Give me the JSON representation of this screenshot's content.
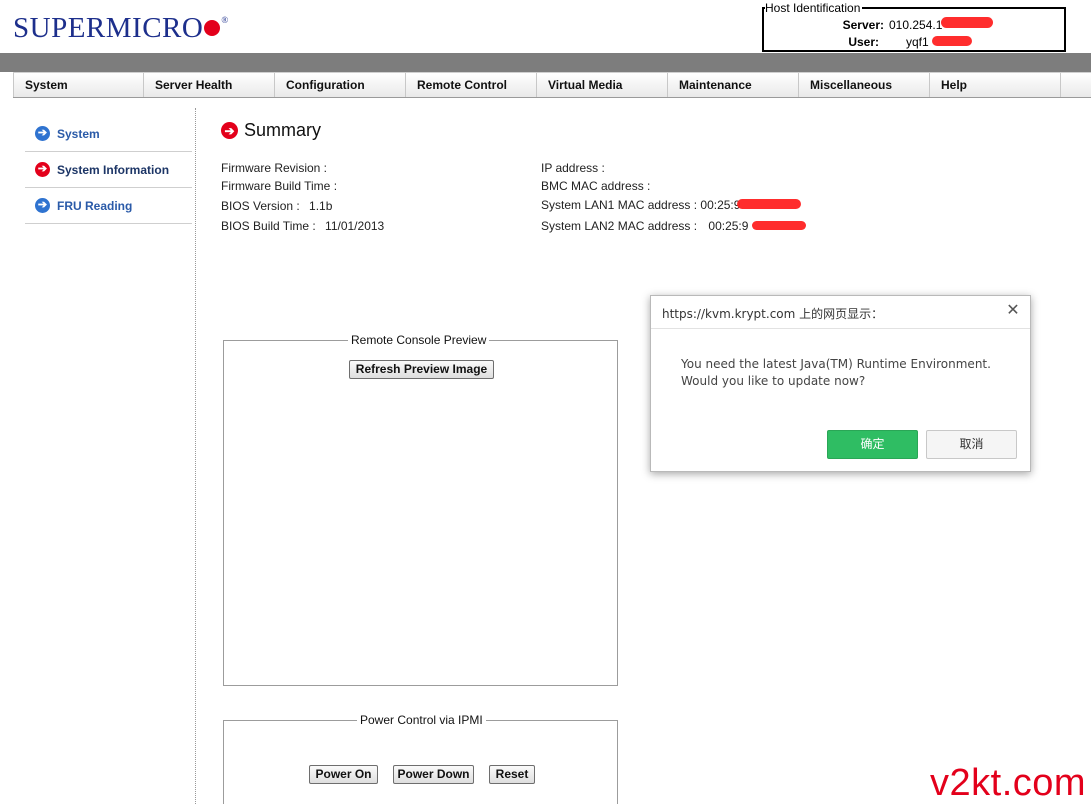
{
  "header": {
    "logo_text": "SUPERMICRO",
    "logo_registered": "®",
    "host": {
      "legend": "Host Identification",
      "server_label": "Server:",
      "server_value": "010.254.1",
      "user_label": "User:",
      "user_value": "yqf1"
    }
  },
  "nav": {
    "items": [
      "System",
      "Server Health",
      "Configuration",
      "Remote Control",
      "Virtual Media",
      "Maintenance",
      "Miscellaneous",
      "Help"
    ]
  },
  "sidebar": {
    "items": [
      {
        "label": "System",
        "active": false
      },
      {
        "label": "System Information",
        "active": true
      },
      {
        "label": "FRU Reading",
        "active": false
      }
    ]
  },
  "summary": {
    "title": "Summary",
    "left": [
      {
        "label": "Firmware Revision :",
        "value": ""
      },
      {
        "label": "Firmware Build Time :",
        "value": ""
      },
      {
        "label": "BIOS Version :",
        "value": "1.1b"
      },
      {
        "label": "BIOS Build Time :",
        "value": "11/01/2013"
      }
    ],
    "right": [
      {
        "label": "IP address :",
        "value": ""
      },
      {
        "label": "BMC MAC address :",
        "value": ""
      },
      {
        "label": "System LAN1 MAC address :",
        "value": "00:25:9"
      },
      {
        "label": "System LAN2 MAC address :",
        "value": "00:25:9"
      }
    ]
  },
  "preview": {
    "legend": "Remote Console Preview",
    "refresh_label": "Refresh Preview Image"
  },
  "power": {
    "legend": "Power Control via IPMI",
    "on_label": "Power On",
    "down_label": "Power Down",
    "reset_label": "Reset"
  },
  "dialog": {
    "title": "https://kvm.krypt.com 上的网页显示：",
    "message_line1": "You need the latest Java(TM) Runtime Environment.",
    "message_line2": "Would you like to update now?",
    "ok_label": "确定",
    "cancel_label": "取消"
  },
  "watermark": "v2kt.com",
  "colors": {
    "brand_blue": "#1d2f8c",
    "brand_red": "#e3001b",
    "link_blue": "#2a5aa8",
    "ok_green": "#2fbd63"
  }
}
